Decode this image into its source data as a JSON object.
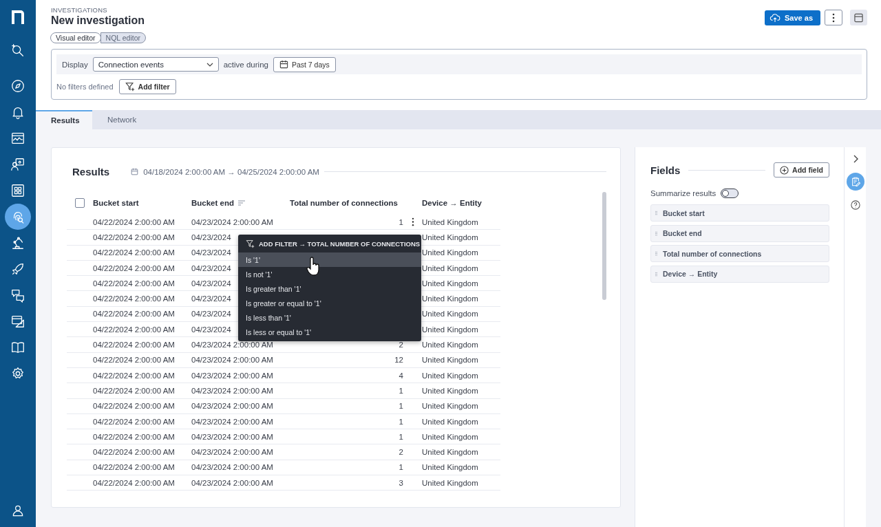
{
  "sidebar": {
    "items": [
      {
        "selected": false
      },
      {
        "selected": false
      },
      {
        "selected": false
      },
      {
        "selected": false
      },
      {
        "selected": false
      },
      {
        "selected": false
      },
      {
        "selected": true
      },
      {
        "selected": false
      },
      {
        "selected": false
      },
      {
        "selected": false
      },
      {
        "selected": false
      },
      {
        "selected": false
      },
      {
        "selected": false
      }
    ]
  },
  "header": {
    "breadcrumb": "INVESTIGATIONS",
    "title": "New investigation",
    "save_button": "Save as"
  },
  "editor_toggle": [
    {
      "label": "Visual editor",
      "selected": true
    },
    {
      "label": "NQL editor",
      "selected": false
    }
  ],
  "query": {
    "display_label": "Display",
    "object_select": "Connection events",
    "during_label": "active during",
    "time_button": "Past 7 days",
    "filters_note": "No filters defined",
    "add_filter_button": "Add filter"
  },
  "tabs": [
    {
      "label": "Results",
      "selected": true
    },
    {
      "label": "Network",
      "selected": false
    }
  ],
  "results": {
    "title": "Results",
    "time_range": "04/18/2024 2:00:00 AM → 04/25/2024 2:00:00 AM",
    "select_all": {
      "checked": false
    },
    "columns": [
      {
        "label": "Bucket start",
        "sorted": false
      },
      {
        "label": "Bucket end",
        "sorted": true
      },
      {
        "label": "Total number of connections",
        "sorted": false
      },
      {
        "label": "Device → Entity",
        "sorted": false
      }
    ],
    "rows": [
      {
        "bucket_start": "04/22/2024 2:00:00 AM",
        "bucket_end": "04/23/2024 2:00:00 AM",
        "total": "1",
        "device": "United Kingdom",
        "hovered": true
      },
      {
        "bucket_start": "04/22/2024 2:00:00 AM",
        "bucket_end": "04/23/2024",
        "device": "United Kingdom",
        "hovered": false
      },
      {
        "bucket_start": "04/22/2024 2:00:00 AM",
        "bucket_end": "04/23/2024",
        "device": "United Kingdom",
        "hovered": false
      },
      {
        "bucket_start": "04/22/2024 2:00:00 AM",
        "bucket_end": "04/23/2024",
        "device": "United Kingdom",
        "hovered": false
      },
      {
        "bucket_start": "04/22/2024 2:00:00 AM",
        "bucket_end": "04/23/2024",
        "device": "United Kingdom",
        "hovered": false
      },
      {
        "bucket_start": "04/22/2024 2:00:00 AM",
        "bucket_end": "04/23/2024",
        "device": "United Kingdom",
        "hovered": false
      },
      {
        "bucket_start": "04/22/2024 2:00:00 AM",
        "bucket_end": "04/23/2024",
        "device": "United Kingdom",
        "hovered": false
      },
      {
        "bucket_start": "04/22/2024 2:00:00 AM",
        "bucket_end": "04/23/2024",
        "device": "United Kingdom",
        "hovered": false
      },
      {
        "bucket_start": "04/22/2024 2:00:00 AM",
        "bucket_end": "04/23/2024 2:00:00 AM",
        "total": "2",
        "device": "United Kingdom",
        "hovered": false
      },
      {
        "bucket_start": "04/22/2024 2:00:00 AM",
        "bucket_end": "04/23/2024 2:00:00 AM",
        "total": "12",
        "device": "United Kingdom",
        "hovered": false
      },
      {
        "bucket_start": "04/22/2024 2:00:00 AM",
        "bucket_end": "04/23/2024 2:00:00 AM",
        "total": "4",
        "device": "United Kingdom",
        "hovered": false
      },
      {
        "bucket_start": "04/22/2024 2:00:00 AM",
        "bucket_end": "04/23/2024 2:00:00 AM",
        "total": "1",
        "device": "United Kingdom",
        "hovered": false
      },
      {
        "bucket_start": "04/22/2024 2:00:00 AM",
        "bucket_end": "04/23/2024 2:00:00 AM",
        "total": "1",
        "device": "United Kingdom",
        "hovered": false
      },
      {
        "bucket_start": "04/22/2024 2:00:00 AM",
        "bucket_end": "04/23/2024 2:00:00 AM",
        "total": "1",
        "device": "United Kingdom",
        "hovered": false
      },
      {
        "bucket_start": "04/22/2024 2:00:00 AM",
        "bucket_end": "04/23/2024 2:00:00 AM",
        "total": "1",
        "device": "United Kingdom",
        "hovered": false
      },
      {
        "bucket_start": "04/22/2024 2:00:00 AM",
        "bucket_end": "04/23/2024 2:00:00 AM",
        "total": "2",
        "device": "United Kingdom",
        "hovered": false
      },
      {
        "bucket_start": "04/22/2024 2:00:00 AM",
        "bucket_end": "04/23/2024 2:00:00 AM",
        "total": "1",
        "device": "United Kingdom",
        "hovered": false
      },
      {
        "bucket_start": "04/22/2024 2:00:00 AM",
        "bucket_end": "04/23/2024 2:00:00 AM",
        "total": "3",
        "device": "United Kingdom",
        "hovered": false
      }
    ]
  },
  "filter_menu": {
    "header": "ADD FILTER → TOTAL NUMBER OF CONNECTIONS",
    "items": [
      {
        "label": "Is '1'",
        "selected": true
      },
      {
        "label": "Is not '1'",
        "selected": false
      },
      {
        "label": "Is greater than '1'",
        "selected": false
      },
      {
        "label": "Is greater or equal to '1'",
        "selected": false
      },
      {
        "label": "Is less than '1'",
        "selected": false
      },
      {
        "label": "Is less or equal to '1'",
        "selected": false
      }
    ]
  },
  "fields": {
    "title": "Fields",
    "add_button": "Add field",
    "summarize_label": "Summarize results",
    "summarize": {
      "on": false
    },
    "items": [
      {
        "label": "Bucket start"
      },
      {
        "label": "Bucket end"
      },
      {
        "label": "Total number of connections"
      },
      {
        "label": "Device → Entity"
      }
    ]
  }
}
